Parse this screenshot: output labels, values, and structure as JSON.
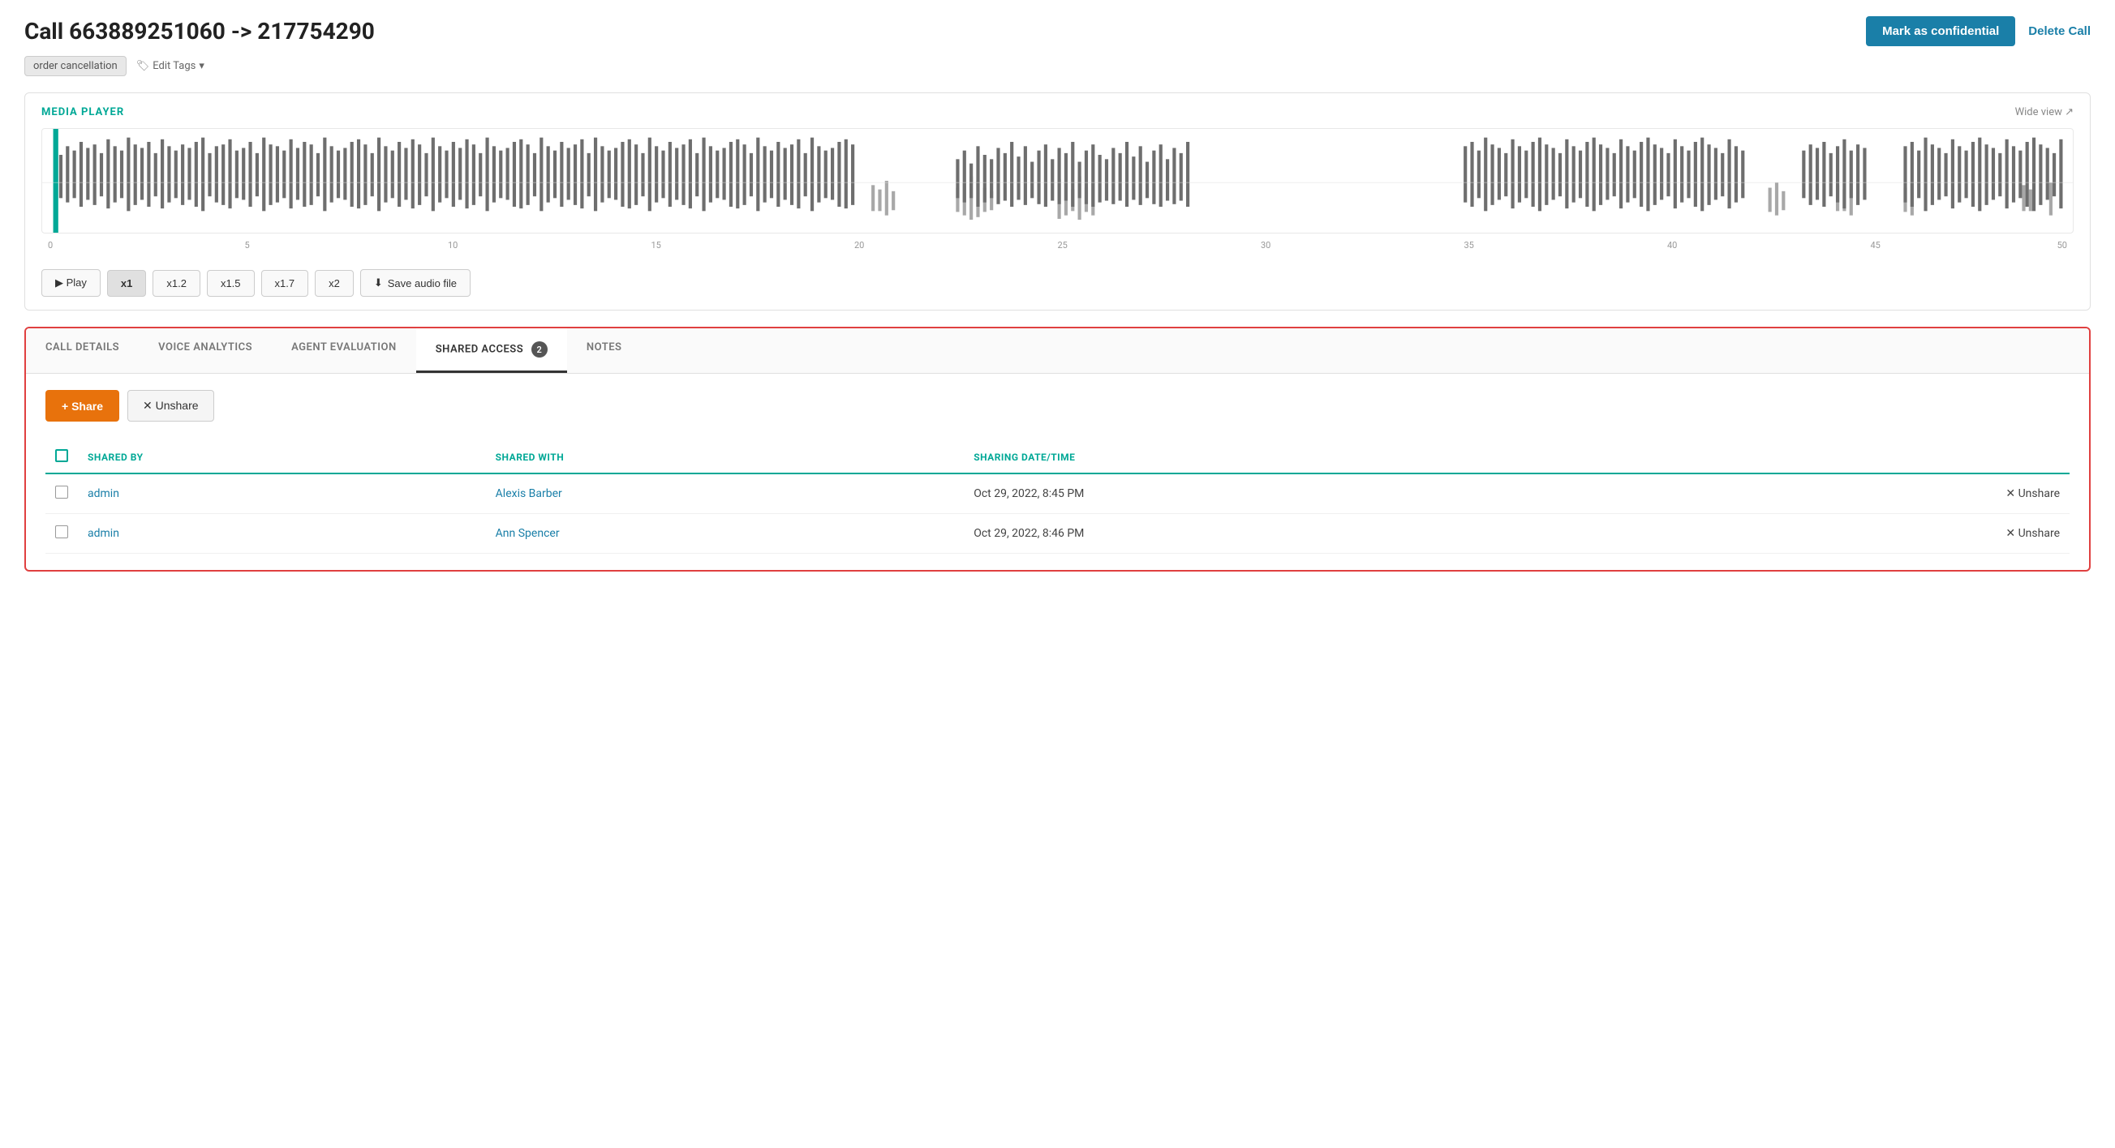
{
  "header": {
    "title": "Call 663889251060 -> 217754290",
    "mark_confidential_label": "Mark as confidential",
    "delete_call_label": "Delete Call"
  },
  "tags": {
    "tag1": "order cancellation",
    "edit_tags_label": "Edit Tags"
  },
  "media_player": {
    "section_title": "MEDIA PLAYER",
    "wide_view_label": "Wide view ↗",
    "timeline_marks": [
      "0",
      "5",
      "10",
      "15",
      "20",
      "25",
      "30",
      "35",
      "40",
      "45",
      "50"
    ],
    "play_label": "▶ Play",
    "speeds": [
      "x1",
      "x1.2",
      "x1.5",
      "x1.7",
      "x2"
    ],
    "active_speed": "x1",
    "save_audio_label": "⬇ Save audio file"
  },
  "tabs": {
    "items": [
      {
        "id": "call-details",
        "label": "CALL DETAILS",
        "active": false,
        "badge": null
      },
      {
        "id": "voice-analytics",
        "label": "VOICE ANALYTICS",
        "active": false,
        "badge": null
      },
      {
        "id": "agent-evaluation",
        "label": "AGENT EVALUATION",
        "active": false,
        "badge": null
      },
      {
        "id": "shared-access",
        "label": "SHARED ACCESS",
        "active": true,
        "badge": "2"
      },
      {
        "id": "notes",
        "label": "NOTES",
        "active": false,
        "badge": null
      }
    ]
  },
  "shared_access": {
    "share_label": "+ Share",
    "unshare_label": "✕ Unshare",
    "columns": {
      "shared_by": "SHARED BY",
      "shared_with": "SHARED WITH",
      "sharing_datetime": "SHARING DATE/TIME"
    },
    "rows": [
      {
        "shared_by": "admin",
        "shared_with": "Alexis Barber",
        "sharing_datetime": "Oct 29, 2022, 8:45 PM",
        "unshare_label": "✕ Unshare"
      },
      {
        "shared_by": "admin",
        "shared_with": "Ann Spencer",
        "sharing_datetime": "Oct 29, 2022, 8:46 PM",
        "unshare_label": "✕ Unshare"
      }
    ]
  },
  "colors": {
    "teal": "#00a896",
    "orange": "#e8720c",
    "blue": "#1a7fa8",
    "red_border": "#e04040"
  }
}
